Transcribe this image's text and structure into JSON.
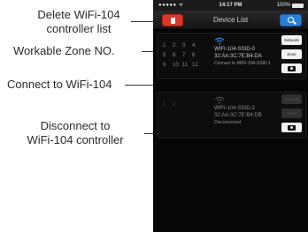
{
  "annotations": {
    "delete_line1": "Delete WiFi-104",
    "delete_line2": "controller list",
    "zone": "Workable Zone NO.",
    "connect": "Connect to WiFi-104",
    "disconnect_line1": "Disconnect to",
    "disconnect_line2": "WiFi-104 controller"
  },
  "status_bar": {
    "signal": "●●●●● ᯤ",
    "time": "14:17 PM",
    "battery": "100%"
  },
  "nav": {
    "title": "Device List",
    "delete_icon": "trash-icon",
    "search_icon": "search-icon"
  },
  "devices": [
    {
      "zones": [
        "1",
        "2",
        "3",
        "4",
        "5",
        "6",
        "7",
        "8",
        "9",
        "10",
        "11",
        "12"
      ],
      "ssid": "WIFI-104-SSID-0",
      "mac": "32:AA:3C:7E:B4:DA",
      "status": "Connect to WIFI-104-SSID-1",
      "btn_network": "Network",
      "btn_zone": "Zone",
      "connected": true,
      "wifi_color": "#2f8de4"
    },
    {
      "zones": [
        "1",
        "2"
      ],
      "ssid": "WIFI-104-SSID-2",
      "mac": "32:AA:3C:7E:B4:DB",
      "status": "Disconnected",
      "btn_network": "Network",
      "btn_zone": "Zone",
      "connected": false,
      "wifi_color": "#5a5a5a"
    }
  ]
}
